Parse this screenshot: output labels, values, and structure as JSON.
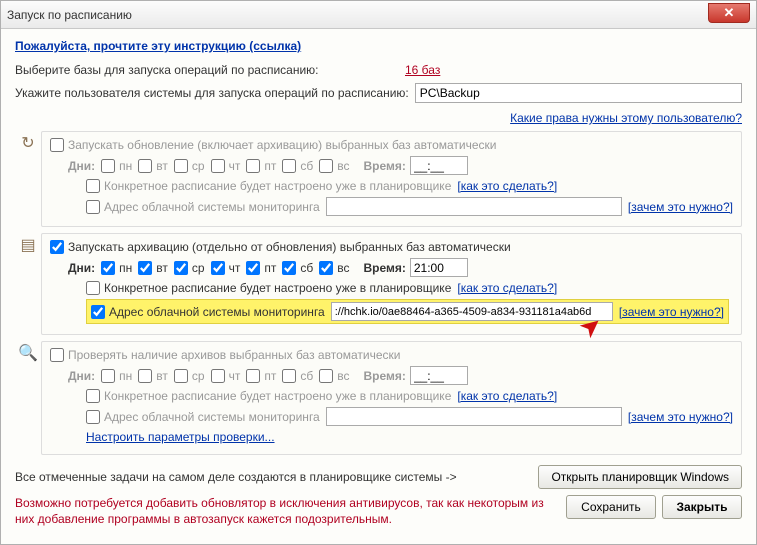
{
  "window": {
    "title": "Запуск по расписанию",
    "close_glyph": "✕"
  },
  "instruction_link": "Пожалуйста, прочтите эту инструкцию (ссылка)",
  "select_bases_label": "Выберите базы для запуска операций по расписанию:",
  "bases_value": "16 баз",
  "user_label": "Укажите пользователя системы для запуска операций по расписанию:",
  "user_value": "PC\\Backup",
  "user_rights_link": "Какие права нужны этому пользователю?",
  "icons": {
    "refresh": "↻",
    "archive": "▤",
    "search": "🔍"
  },
  "days": {
    "mon": "пн",
    "tue": "вт",
    "wed": "ср",
    "thu": "чт",
    "fri": "пт",
    "sat": "сб",
    "sun": "вс"
  },
  "group_update": {
    "title": "Запускать обновление (включает архивацию) выбранных баз автоматически",
    "days_label": "Дни:",
    "time_label": "Время:",
    "time_value": "__:__",
    "concrete_label": "Конкретное расписание будет настроено уже в планировщике",
    "how_link": "[как это сделать?]",
    "mon_label": "Адрес облачной системы мониторинга",
    "mon_value": "",
    "why_link": "[зачем это нужно?]"
  },
  "group_archive": {
    "title": "Запускать архивацию (отдельно от обновления) выбранных баз автоматически",
    "days_label": "Дни:",
    "time_label": "Время:",
    "time_value": "21:00",
    "concrete_label": "Конкретное расписание будет настроено уже в планировщике",
    "how_link": "[как это сделать?]",
    "mon_label": "Адрес облачной системы мониторинга",
    "mon_value": "://hchk.io/0ae88464-a365-4509-a834-931181a4ab6d",
    "why_link": "[зачем это нужно?]"
  },
  "group_check": {
    "title": "Проверять наличие архивов выбранных баз автоматически",
    "days_label": "Дни:",
    "time_label": "Время:",
    "time_value": "__:__",
    "concrete_label": "Конкретное расписание будет настроено уже в планировщике",
    "how_link": "[как это сделать?]",
    "mon_label": "Адрес облачной системы мониторинга",
    "mon_value": "",
    "why_link": "[зачем это нужно?]",
    "config_link": "Настроить параметры проверки..."
  },
  "footer_note": "Все отмеченные задачи на самом деле создаются в планировщике системы ->",
  "open_scheduler_btn": "Открыть планировщик Windows",
  "warning": "Возможно потребуется добавить обновлятор в исключения антивирусов, так как некоторым из них добавление программы в автозапуск кажется подозрительным.",
  "save_btn": "Сохранить",
  "close_btn": "Закрыть",
  "arrow_glyph": "➤"
}
